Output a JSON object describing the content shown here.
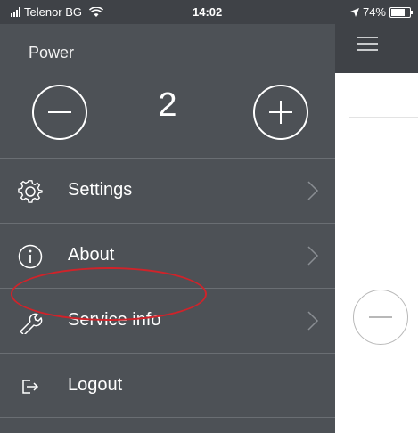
{
  "status": {
    "carrier": "Telenor BG",
    "time": "14:02",
    "battery": "74%",
    "battery_fraction": 0.74
  },
  "power": {
    "label": "Power",
    "value": "2"
  },
  "menu": {
    "items": [
      {
        "icon": "gear-icon",
        "label": "Settings"
      },
      {
        "icon": "info-icon",
        "label": "About"
      },
      {
        "icon": "wrench-icon",
        "label": "Service info"
      },
      {
        "icon": "logout-icon",
        "label": "Logout"
      }
    ]
  },
  "colors": {
    "drawer": "#4d5156",
    "statusbar": "#3f4247",
    "highlight": "#d0232a"
  }
}
